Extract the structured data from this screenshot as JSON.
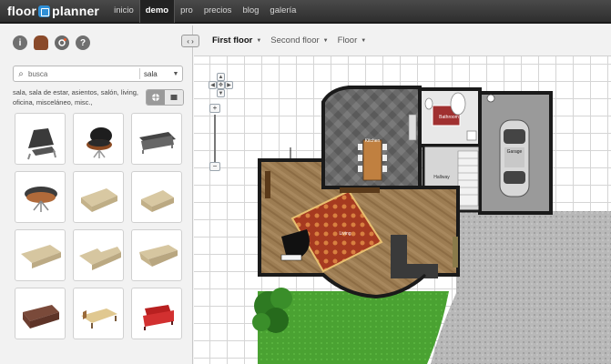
{
  "app": {
    "logo_left": "floor",
    "logo_right": "planner"
  },
  "nav": {
    "items": [
      {
        "label": "inicio",
        "active": false
      },
      {
        "label": "demo",
        "active": true
      },
      {
        "label": "pro",
        "active": false
      },
      {
        "label": "precios",
        "active": false
      },
      {
        "label": "blog",
        "active": false
      },
      {
        "label": "galería",
        "active": false
      }
    ]
  },
  "tools": {
    "info_icon": "i",
    "help_icon": "?"
  },
  "search": {
    "placeholder": "busca",
    "category": "sala",
    "tags": "sala, sala de estar, asientos, salón, living, oficina, misceláneo, misc.,"
  },
  "floors": {
    "tabs": [
      {
        "label": "First floor",
        "active": true
      },
      {
        "label": "Second floor",
        "active": false
      },
      {
        "label": "Floor",
        "active": false
      }
    ]
  },
  "plan": {
    "rooms": {
      "kitchen": "Kitchen",
      "bathroom": "Bathroom",
      "hallway": "Hallway",
      "garage": "Garage",
      "living": "Living"
    }
  },
  "colors": {
    "nav_bg": "#3a3a3a",
    "wood_floor": "#a0825a",
    "tile_floor": "#6e6e6e",
    "grass": "#4fa83a",
    "wall": "#1a1a1a"
  }
}
